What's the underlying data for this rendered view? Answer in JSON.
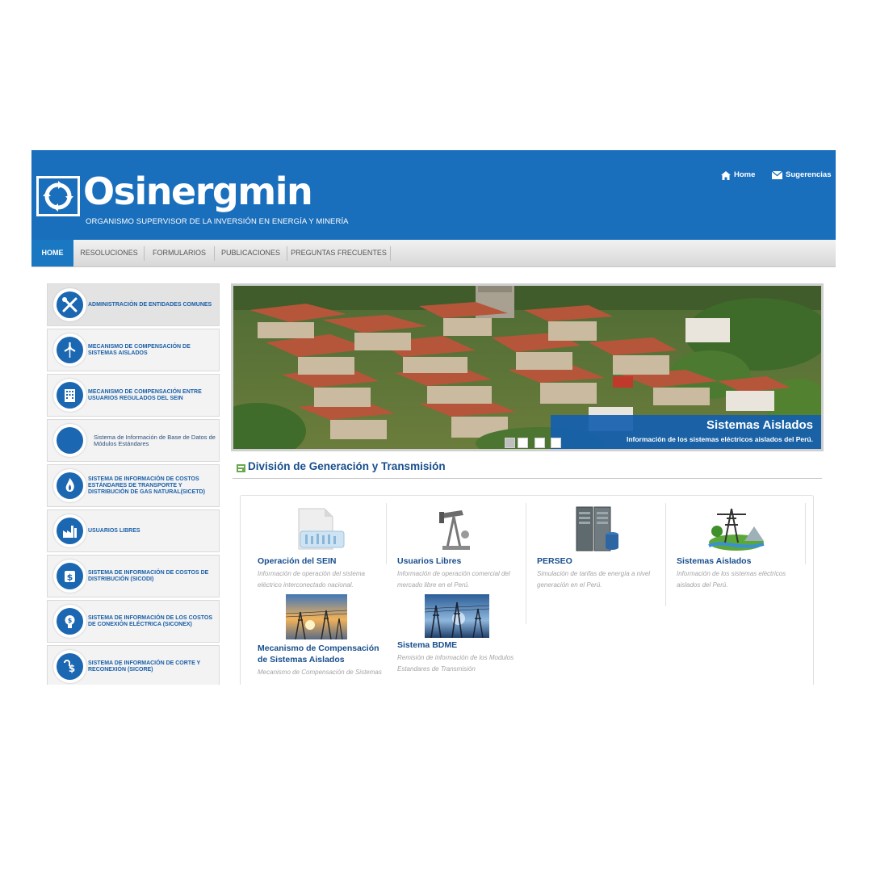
{
  "header": {
    "brand_name": "Osinergmin",
    "tagline": "ORGANISMO SUPERVISOR DE LA INVERSIÓN EN ENERGÍA Y MINERÍA",
    "links": [
      {
        "label": "Home",
        "icon": "home-icon"
      },
      {
        "label": "Sugerencias",
        "icon": "envelope-icon"
      }
    ]
  },
  "nav": {
    "items": [
      {
        "label": "HOME",
        "active": true
      },
      {
        "label": "RESOLUCIONES",
        "active": false
      },
      {
        "label": "FORMULARIOS",
        "active": false
      },
      {
        "label": "PUBLICACIONES",
        "active": false
      },
      {
        "label": "PREGUNTAS FRECUENTES",
        "active": false
      }
    ]
  },
  "sidebar": {
    "items": [
      {
        "label": "ADMINISTRACIÓN DE ENTIDADES COMUNES",
        "icon": "tools-icon"
      },
      {
        "label": "MECANISMO DE COMPENSACIÓN DE SISTEMAS AISLADOS",
        "icon": "wind-turbine-icon"
      },
      {
        "label": "MECANISMO DE COMPENSACIÓN ENTRE USUARIOS REGULADOS DEL SEIN",
        "icon": "building-icon"
      },
      {
        "label": "Sistema de Información de Base de Datos de Módulos Estándares",
        "icon": ""
      },
      {
        "label": "SISTEMA DE INFORMACIÓN DE COSTOS ESTÁNDARES DE TRANSPORTE Y DISTRIBUCIÓN DE GAS NATURAL(SICETD)",
        "icon": "gas-flame-icon"
      },
      {
        "label": "USUARIOS LIBRES",
        "icon": "factory-icon"
      },
      {
        "label": "SISTEMA DE INFORMACIÓN DE COSTOS DE DISTRIBUCIÓN (SICODI)",
        "icon": "money-icon"
      },
      {
        "label": "SISTEMA DE INFORMACIÓN DE LOS COSTOS DE CONEXIÓN ELÉCTRICA (SICONEX)",
        "icon": "lightbulb-icon"
      },
      {
        "label": "SISTEMA DE INFORMACIÓN DE CORTE Y RECONEXIÓN (SICORE)",
        "icon": "plug-money-icon"
      }
    ]
  },
  "banner": {
    "title": "Sistemas Aislados",
    "subtitle": "Información de los sistemas eléctricos aislados del Perú.",
    "active_slide": 1,
    "slide_count": 4
  },
  "section": {
    "title": "División de Generación y Transmisión"
  },
  "cards": [
    {
      "title": "Operación del SEIN",
      "desc": "Información de operación del sistema eléctrico interconectado nacional.",
      "icon": "document-chart-icon"
    },
    {
      "title": "Usuarios Libres",
      "desc": "Información de operación comercial del mercado libre en el Perú.",
      "icon": "oil-pump-icon"
    },
    {
      "title": "PERSEO",
      "desc": "Simulación de tarifas de energía a nivel generación en el Perú.",
      "icon": "server-icon"
    },
    {
      "title": "Sistemas Aislados",
      "desc": "Información de los sistemas eléctricos aislados del Perú.",
      "icon": "power-tower-landscape-icon"
    },
    {
      "title": "Mecanismo de Compensación de Sistemas Aislados",
      "desc": "Mecanismo de Compensación de Sistemas Aislados",
      "icon": "power-lines-sunset-photo"
    },
    {
      "title": "Sistema BDME",
      "desc": "Remisión de información de los Modulos Estandares de Transmisión",
      "icon": "power-lines-blue-photo"
    }
  ],
  "colors": {
    "brand_blue": "#1a6fbd",
    "nav_active": "#1a78c2",
    "link_blue": "#184e8d"
  }
}
